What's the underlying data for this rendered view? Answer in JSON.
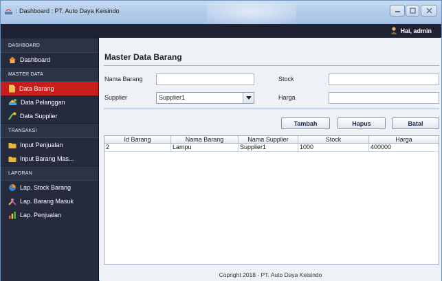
{
  "window": {
    "title": ": Dashboard : PT. Auto Daya Keisindo",
    "controls": {
      "minimize_icon": "minimize-icon",
      "maximize_icon": "maximize-icon",
      "close_icon": "close-icon"
    }
  },
  "topbar": {
    "greeting": "Hai, admin",
    "user_icon": "user-icon"
  },
  "sidebar": {
    "sections": [
      {
        "label": "DASHBOARD",
        "items": [
          {
            "label": "Dashboard",
            "icon": "home-icon",
            "active": false
          }
        ]
      },
      {
        "label": "MASTER DATA",
        "items": [
          {
            "label": "Data Barang",
            "icon": "document-icon",
            "active": true
          },
          {
            "label": "Data Pelanggan",
            "icon": "customer-icon",
            "active": false
          },
          {
            "label": "Data Supplier",
            "icon": "supplier-icon",
            "active": false
          }
        ]
      },
      {
        "label": "TRANSAKSI",
        "items": [
          {
            "label": "Input Penjualan",
            "icon": "folder-icon",
            "active": false
          },
          {
            "label": "Input Barang Mas...",
            "icon": "folder-icon",
            "active": false
          }
        ]
      },
      {
        "label": "LAPORAN",
        "items": [
          {
            "label": "Lap. Stock Barang",
            "icon": "pie-chart-icon",
            "active": false
          },
          {
            "label": "Lap. Barang Masuk",
            "icon": "tools-icon",
            "active": false
          },
          {
            "label": "Lap. Penjualan",
            "icon": "bar-chart-icon",
            "active": false
          }
        ]
      }
    ]
  },
  "main": {
    "title": "Master Data Barang",
    "form": {
      "nama_barang": {
        "label": "Nama Barang",
        "value": ""
      },
      "stock": {
        "label": "Stock",
        "value": ""
      },
      "supplier": {
        "label": "Supplier",
        "value": "Supplier1"
      },
      "harga": {
        "label": "Harga",
        "value": ""
      }
    },
    "buttons": {
      "tambah": "Tambah",
      "hapus": "Hapus",
      "batal": "Batal"
    },
    "table": {
      "columns": [
        "Id Barang",
        "Nama Barang",
        "Nama Supplier",
        "Stock",
        "Harga"
      ],
      "rows": [
        [
          "2",
          "Lampu",
          "Supplier1",
          "1000",
          "400000"
        ]
      ]
    },
    "footer": "Copright 2018 - PT. Auto Daya Keisindo"
  },
  "colors": {
    "sidebar_bg": "#252a3d",
    "active_item": "#c81d1d",
    "topbar_bg": "#1f2233"
  }
}
